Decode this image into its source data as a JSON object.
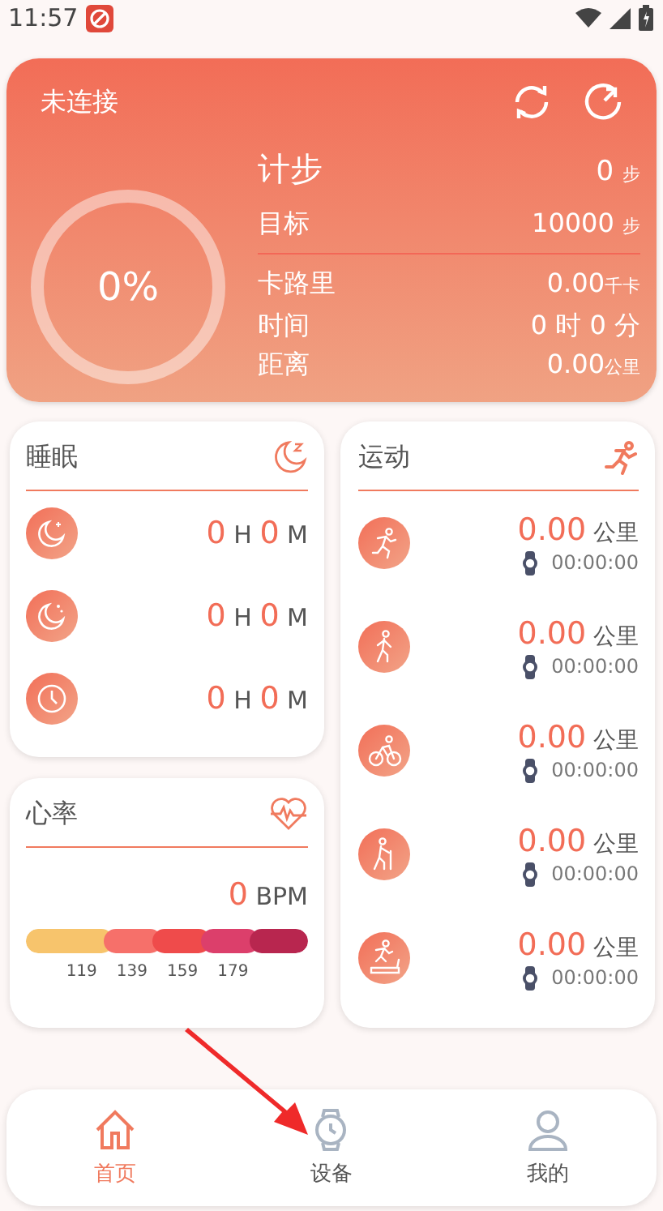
{
  "status_bar": {
    "time": "11:57"
  },
  "summary": {
    "status": "未连接",
    "ring": {
      "label": "0%",
      "level": 0
    },
    "steps": {
      "label": "计步",
      "value": "0",
      "unit": "步"
    },
    "goal": {
      "label": "目标",
      "value": "10000",
      "unit": "步"
    },
    "stats": [
      {
        "label": "卡路里",
        "value": "0.00",
        "unit": "千卡"
      },
      {
        "label": "时间",
        "value": "0 时 0 分"
      },
      {
        "label": "距离",
        "value": "0.00",
        "unit": "公里"
      }
    ]
  },
  "sleep": {
    "title": "睡眠",
    "rows": [
      {
        "kind": "deep",
        "hours": "0",
        "h_unit": "H",
        "minutes": "0",
        "m_unit": "M"
      },
      {
        "kind": "light",
        "hours": "0",
        "h_unit": "H",
        "minutes": "0",
        "m_unit": "M"
      },
      {
        "kind": "awake",
        "hours": "0",
        "h_unit": "H",
        "minutes": "0",
        "m_unit": "M"
      }
    ]
  },
  "heart_rate": {
    "title": "心率",
    "value": "0",
    "unit": "BPM",
    "zones": [
      {
        "color": "#f7c46c"
      },
      {
        "color": "#f6706a"
      },
      {
        "color": "#ef4b4b"
      },
      {
        "color": "#dc3f6b"
      },
      {
        "color": "#b8264f"
      }
    ],
    "ticks": [
      "119",
      "139",
      "159",
      "179"
    ]
  },
  "sport": {
    "title": "运动",
    "rows": [
      {
        "kind": "run",
        "distance": "0.00",
        "unit": "公里",
        "time": "00:00:00"
      },
      {
        "kind": "walk",
        "distance": "0.00",
        "unit": "公里",
        "time": "00:00:00"
      },
      {
        "kind": "cycle",
        "distance": "0.00",
        "unit": "公里",
        "time": "00:00:00"
      },
      {
        "kind": "hike",
        "distance": "0.00",
        "unit": "公里",
        "time": "00:00:00"
      },
      {
        "kind": "treadmill",
        "distance": "0.00",
        "unit": "公里",
        "time": "00:00:00"
      }
    ]
  },
  "nav": [
    {
      "kind": "home",
      "label": "首页",
      "selected": true
    },
    {
      "kind": "device",
      "label": "设备",
      "selected": false
    },
    {
      "kind": "profile",
      "label": "我的",
      "selected": false
    }
  ]
}
